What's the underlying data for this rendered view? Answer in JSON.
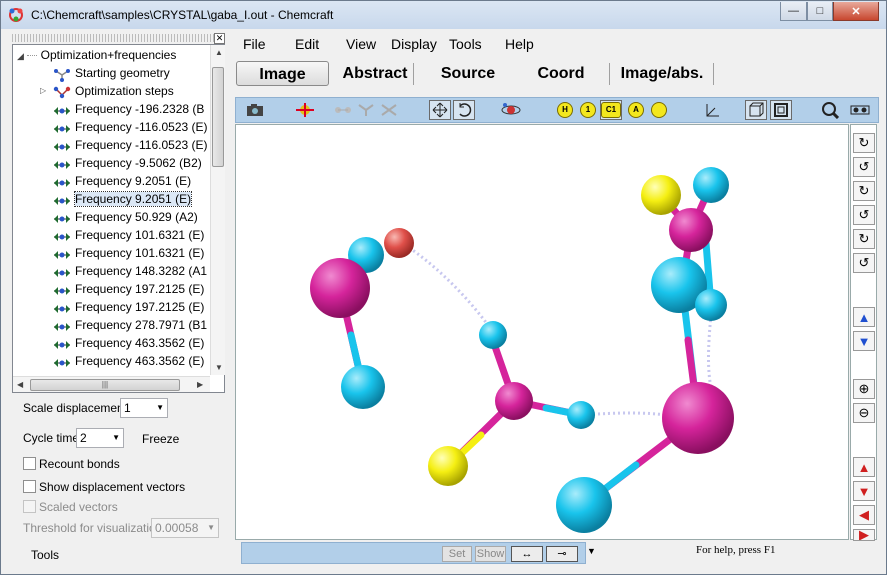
{
  "window": {
    "title": "C:\\Chemcraft\\samples\\CRYSTAL\\gaba_I.out - Chemcraft",
    "minimize": "—",
    "maximize": "□",
    "close": "✕"
  },
  "menu": [
    "File",
    "Edit",
    "View",
    "Display",
    "Tools",
    "Help"
  ],
  "tabs": [
    "Image",
    "Abstract",
    "Source",
    "Coord",
    "Image/abs."
  ],
  "active_tab": "Image",
  "tree": {
    "root": "Optimization+frequencies",
    "items": [
      {
        "label": "Starting geometry",
        "icon": "geometry-icon"
      },
      {
        "label": "Optimization steps",
        "icon": "steps-icon"
      },
      {
        "label": "Frequency -196.2328 (B",
        "icon": "frequency-icon"
      },
      {
        "label": "Frequency -116.0523 (E)",
        "icon": "frequency-icon"
      },
      {
        "label": "Frequency -116.0523 (E)",
        "icon": "frequency-icon"
      },
      {
        "label": "Frequency -9.5062 (B2)",
        "icon": "frequency-icon"
      },
      {
        "label": "Frequency 9.2051 (E)",
        "icon": "frequency-icon"
      },
      {
        "label": "Frequency 9.2051 (E)",
        "icon": "frequency-icon",
        "selected": true
      },
      {
        "label": "Frequency 50.929 (A2)",
        "icon": "frequency-icon"
      },
      {
        "label": "Frequency 101.6321 (E)",
        "icon": "frequency-icon"
      },
      {
        "label": "Frequency 101.6321 (E)",
        "icon": "frequency-icon"
      },
      {
        "label": "Frequency 148.3282 (A1",
        "icon": "frequency-icon"
      },
      {
        "label": "Frequency 197.2125 (E)",
        "icon": "frequency-icon"
      },
      {
        "label": "Frequency 197.2125 (E)",
        "icon": "frequency-icon"
      },
      {
        "label": "Frequency 278.7971 (B1",
        "icon": "frequency-icon"
      },
      {
        "label": "Frequency 463.3562 (E)",
        "icon": "frequency-icon"
      },
      {
        "label": "Frequency 463.3562 (E)",
        "icon": "frequency-icon"
      }
    ]
  },
  "controls": {
    "scale_label": "Scale displacement:",
    "scale_value": "1",
    "cycle_label": "Cycle time:",
    "cycle_value": "2",
    "freeze": "Freeze",
    "recount": "Recount bonds",
    "show_vectors": "Show displacement vectors",
    "scaled_vectors": "Scaled vectors",
    "threshold_label": "Threshold for visualization:",
    "threshold_value": "0.00058",
    "tools": "Tools"
  },
  "toolbar_labels": {
    "h": "H",
    "one": "1",
    "c1": "C1",
    "a": "A"
  },
  "status": {
    "set": "Set",
    "show": "Show",
    "help": "For help, press F1"
  },
  "colors": {
    "magenta": "#d5249b",
    "cyan": "#19c4ec",
    "yellow": "#f5ef12",
    "red": "#e0504a"
  }
}
